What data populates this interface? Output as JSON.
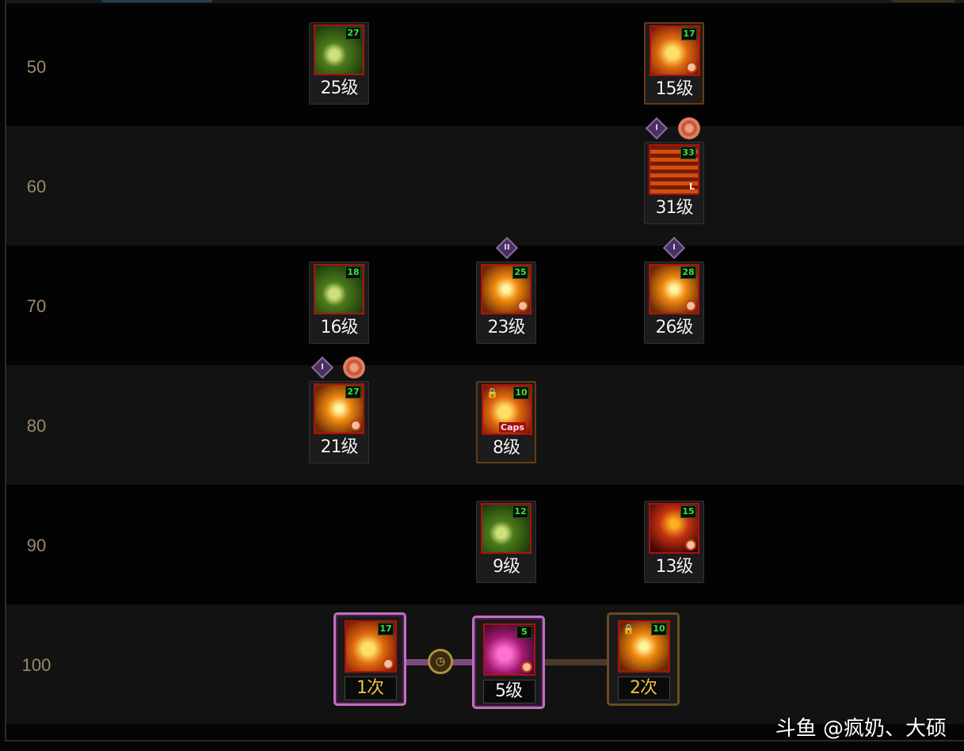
{
  "rows": [
    {
      "level": "50"
    },
    {
      "level": "60"
    },
    {
      "level": "70"
    },
    {
      "level": "80"
    },
    {
      "level": "90"
    },
    {
      "level": "100"
    }
  ],
  "skills": {
    "s50a": {
      "badge": "27",
      "label": "25级",
      "icon": "green-spike-icon"
    },
    "s50b": {
      "badge": "17",
      "label": "15级",
      "icon": "fire-slash-icon"
    },
    "s60b": {
      "badge": "33",
      "label": "31级",
      "icon": "sword-thrust-icon",
      "tag": "L"
    },
    "s70a": {
      "badge": "18",
      "label": "16级",
      "icon": "green-blade-icon"
    },
    "s70b": {
      "badge": "25",
      "label": "23级",
      "icon": "golden-warrior-icon"
    },
    "s70c": {
      "badge": "28",
      "label": "26级",
      "icon": "starburst-icon"
    },
    "s80a": {
      "badge": "27",
      "label": "21级",
      "icon": "golden-heart-icon"
    },
    "s80b": {
      "badge": "10",
      "label": "8级",
      "icon": "fire-comet-icon",
      "caps": "Caps"
    },
    "s90b": {
      "badge": "12",
      "label": "9级",
      "icon": "green-hood-icon"
    },
    "s90c": {
      "badge": "15",
      "label": "13级",
      "icon": "flame-figure-icon"
    }
  },
  "awakening": {
    "a1": {
      "badge": "17",
      "label": "1次"
    },
    "a2": {
      "badge": "5",
      "label": "5级"
    },
    "a3": {
      "badge": "10",
      "label": "2次"
    }
  },
  "runes": {
    "r60": "I",
    "r70b": "II",
    "r70c": "I",
    "r80": "I"
  },
  "watermark": "斗鱼 @疯奶、大硕"
}
